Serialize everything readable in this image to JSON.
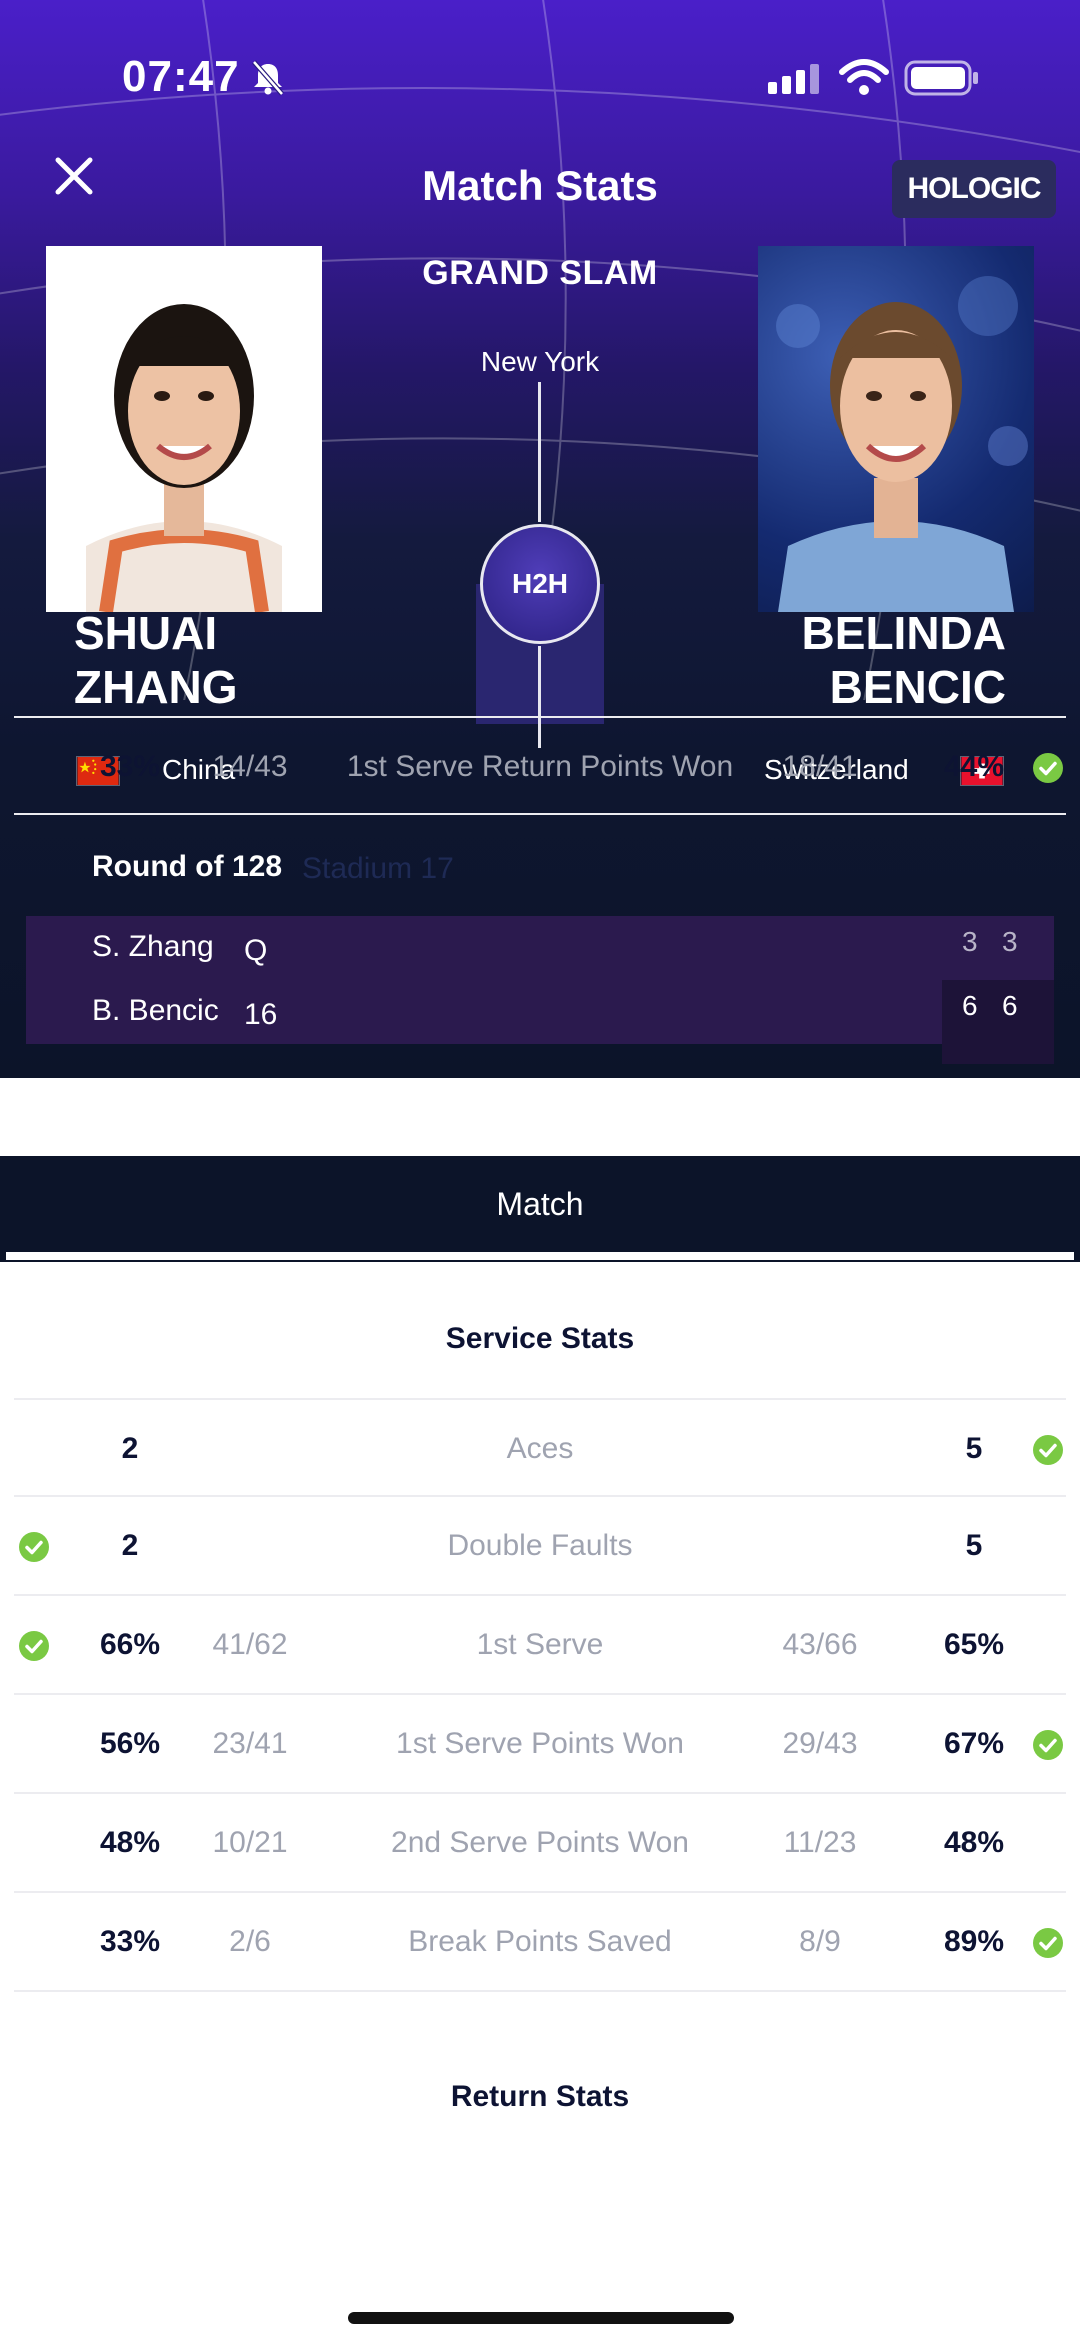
{
  "status": {
    "time": "07:47",
    "icons": [
      "bell-muted-icon",
      "signal-icon",
      "wifi-icon",
      "battery-icon"
    ]
  },
  "header": {
    "title": "Match Stats",
    "sponsor": "HOLOGIC",
    "tournament": "GRAND SLAM",
    "city": "New York",
    "h2h": "H2H"
  },
  "players": {
    "left": {
      "first": "SHUAI",
      "last": "ZHANG",
      "country": "China",
      "flag": "china-flag-icon"
    },
    "right": {
      "first": "BELINDA",
      "last": "BENCIC",
      "country": "Switzerland",
      "flag": "switzerland-flag-icon"
    }
  },
  "match": {
    "round": "Round of 128",
    "court": "Stadium 17",
    "rows": [
      {
        "name": "S. Zhang",
        "seed": "Q",
        "sets": [
          "3",
          "3"
        ]
      },
      {
        "name": "B. Bencic",
        "seed": "16",
        "sets": [
          "6",
          "6"
        ]
      }
    ]
  },
  "tabs": {
    "active": "Match"
  },
  "service": {
    "title": "Service Stats",
    "rows": [
      {
        "label": "Aces",
        "left": "2",
        "left_frac": "",
        "right": "5",
        "right_frac": "",
        "winner": "right"
      },
      {
        "label": "Double Faults",
        "left": "2",
        "left_frac": "",
        "right": "5",
        "right_frac": "",
        "winner": "left"
      },
      {
        "label": "1st Serve",
        "left": "66%",
        "left_frac": "41/62",
        "right": "65%",
        "right_frac": "43/66",
        "winner": "left"
      },
      {
        "label": "1st Serve Points Won",
        "left": "56%",
        "left_frac": "23/41",
        "right": "67%",
        "right_frac": "29/43",
        "winner": "right"
      },
      {
        "label": "2nd Serve Points Won",
        "left": "48%",
        "left_frac": "10/21",
        "right": "48%",
        "right_frac": "11/23",
        "winner": "none"
      },
      {
        "label": "Break Points Saved",
        "left": "33%",
        "left_frac": "2/6",
        "right": "89%",
        "right_frac": "8/9",
        "winner": "right"
      }
    ]
  },
  "return": {
    "title": "Return Stats",
    "rows": [
      {
        "label": "1st Serve Return Points Won",
        "left": "33%",
        "left_frac": "14/43",
        "right": "44%",
        "right_frac": "18/41",
        "winner": "right"
      }
    ]
  },
  "colors": {
    "accent": "#7ac943",
    "header_dark": "#0c1429",
    "score_row": "#2b1a4e"
  }
}
